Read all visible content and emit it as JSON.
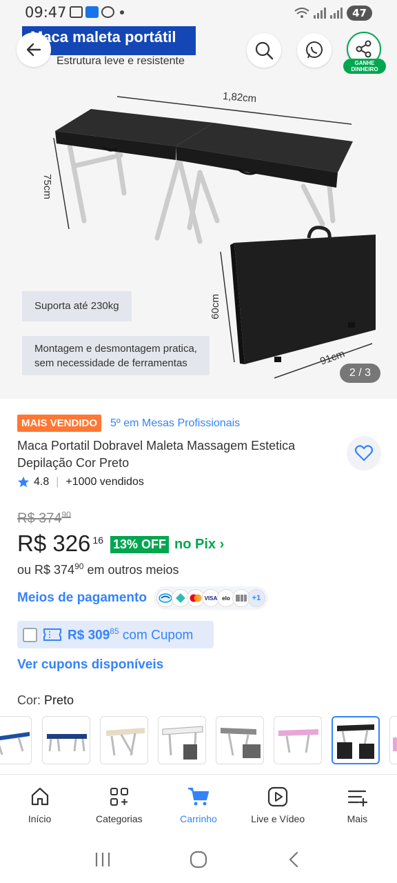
{
  "status_bar": {
    "time": "09:47",
    "battery": "47"
  },
  "gallery": {
    "banner_title": "Maca maleta portátil",
    "banner_subtitle": "Estrutura leve e resistente",
    "dim_length": "1,82cm",
    "dim_height": "75cm",
    "dim_case_height": "60cm",
    "dim_case_width": "91cm",
    "feature_1": "Suporta até 230kg",
    "feature_2_line1": "Montagem e desmontagem pratica,",
    "feature_2_line2": "sem necessidade de ferramentas",
    "share_badge_line1": "GANHE",
    "share_badge_line2": "DINHEIRO",
    "page_indicator": "2 / 3"
  },
  "product": {
    "badge_best_seller": "MAIS VENDIDO",
    "category_rank": "5º em Mesas Profissionais",
    "title": "Maca Portatil Dobravel Maleta Massagem Estetica Depilação Cor Preto",
    "rating": "4.8",
    "sold": "+1000 vendidos"
  },
  "pricing": {
    "old_price": "R$ 374",
    "old_cents": "90",
    "price": "R$ 326",
    "price_cents": "16",
    "discount": "13% OFF",
    "pix_label": "no Pix",
    "alt_prefix": "ou R$ 374",
    "alt_cents": "90",
    "alt_suffix": " em outros meios",
    "payment_link": "Meios de pagamento",
    "payment_more": "+1",
    "coupon_price": "R$ 309",
    "coupon_cents": "85",
    "coupon_suffix": " com Cupom",
    "view_coupons": "Ver cupons disponíveis"
  },
  "variant": {
    "label": "Cor:",
    "value": "Preto"
  },
  "nav": {
    "items": [
      {
        "label": "Início"
      },
      {
        "label": "Categorias"
      },
      {
        "label": "Carrinho"
      },
      {
        "label": "Live e Vídeo"
      },
      {
        "label": "Mais"
      }
    ]
  },
  "colors": {
    "accent": "#3483fa",
    "green": "#00a650",
    "orange": "#ff7733",
    "banner": "#1447b5"
  }
}
